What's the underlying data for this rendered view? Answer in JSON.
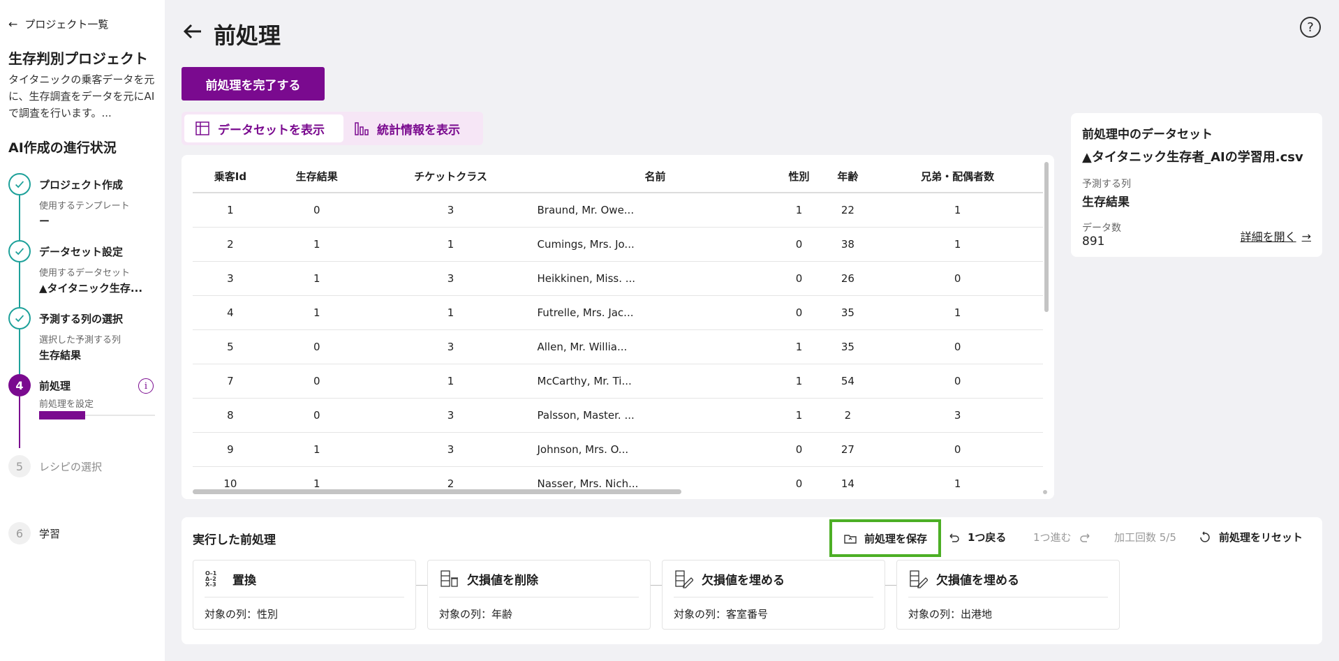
{
  "sidebar": {
    "back_label": "プロジェクト一覧",
    "project_title": "生存判別プロジェクト",
    "project_desc": "タイタニックの乗客データを元に、生存調査をデータを元にAIで調査を行います。...",
    "progress_title": "AI作成の進行状況",
    "steps": [
      {
        "name": "プロジェクト作成",
        "sub": "使用するテンプレート",
        "value": "ー",
        "state": "done"
      },
      {
        "name": "データセット設定",
        "sub": "使用するデータセット",
        "value": "▲タイタニック生存...",
        "state": "done"
      },
      {
        "name": "予測する列の選択",
        "sub": "選択した予測する列",
        "value": "生存結果",
        "state": "done"
      },
      {
        "number": "4",
        "name": "前処理",
        "sub": "前処理を設定",
        "state": "active",
        "progress": 0.4
      },
      {
        "number": "5",
        "name": "レシピの選択",
        "state": "todo"
      },
      {
        "number": "6",
        "name": "学習",
        "state": "todo"
      }
    ]
  },
  "header": {
    "title": "前処理",
    "complete_button": "前処理を完了する"
  },
  "toggle": {
    "dataset_label": "データセットを表示",
    "stats_label": "統計情報を表示"
  },
  "table": {
    "columns": [
      "乗客Id",
      "生存結果",
      "チケットクラス",
      "名前",
      "性別",
      "年齢",
      "兄弟・配偶者数"
    ],
    "rows": [
      [
        "1",
        "0",
        "3",
        "Braund, Mr. Owe...",
        "1",
        "22",
        "1"
      ],
      [
        "2",
        "1",
        "1",
        "Cumings, Mrs. Jo...",
        "0",
        "38",
        "1"
      ],
      [
        "3",
        "1",
        "3",
        "Heikkinen, Miss. ...",
        "0",
        "26",
        "0"
      ],
      [
        "4",
        "1",
        "1",
        "Futrelle, Mrs. Jac...",
        "0",
        "35",
        "1"
      ],
      [
        "5",
        "0",
        "3",
        "Allen, Mr. Willia...",
        "1",
        "35",
        "0"
      ],
      [
        "7",
        "0",
        "1",
        "McCarthy, Mr. Ti...",
        "1",
        "54",
        "0"
      ],
      [
        "8",
        "0",
        "3",
        "Palsson, Master. ...",
        "1",
        "2",
        "3"
      ],
      [
        "9",
        "1",
        "3",
        "Johnson, Mrs. O...",
        "0",
        "27",
        "0"
      ],
      [
        "10",
        "1",
        "2",
        "Nasser, Mrs. Nich...",
        "0",
        "14",
        "1"
      ]
    ]
  },
  "dataset_info": {
    "title": "前処理中のデータセット",
    "filename": "▲タイタニック生存者_AIの学習用.csv",
    "target_label": "予測する列",
    "target_value": "生存結果",
    "count_label": "データ数",
    "count_value": "891",
    "detail_link": "詳細を開く"
  },
  "preprocess": {
    "title": "実行した前処理",
    "save_label": "前処理を保存",
    "undo_label": "1つ戻る",
    "redo_label": "1つ進む",
    "count_text": "加工回数 5/5",
    "reset_label": "前処理をリセット",
    "ops": [
      {
        "name": "置換",
        "icon": "replace-icon",
        "target": "対象の列：性別"
      },
      {
        "name": "欠損値を削除",
        "icon": "delete-missing-icon",
        "target": "対象の列：年齢"
      },
      {
        "name": "欠損値を埋める",
        "icon": "fill-missing-icon",
        "target": "対象の列：客室番号"
      },
      {
        "name": "欠損値を埋める",
        "icon": "fill-missing-icon",
        "target": "対象の列：出港地"
      }
    ]
  },
  "colors": {
    "accent": "#7a0a8f",
    "done": "#1ea19a",
    "highlight": "#4caf25"
  }
}
